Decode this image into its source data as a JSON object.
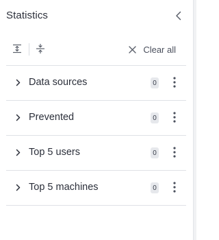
{
  "panel": {
    "title": "Statistics"
  },
  "toolbar": {
    "clear_all_label": "Clear all"
  },
  "rows": [
    {
      "label": "Data sources",
      "count": "0"
    },
    {
      "label": "Prevented",
      "count": "0"
    },
    {
      "label": "Top 5 users",
      "count": "0"
    },
    {
      "label": "Top 5 machines",
      "count": "0"
    }
  ],
  "icons": {
    "collapse": "chevron-left-icon",
    "expand_all": "expand-all-icon",
    "collapse_all": "collapse-all-icon",
    "clear": "close-icon",
    "row_toggle": "chevron-right-icon",
    "row_menu": "kebab-menu-icon"
  },
  "colors": {
    "text": "#2b2f3a",
    "divider": "#dfe1e6",
    "badge_bg": "#e6e8ec",
    "icon": "#5b606b"
  }
}
